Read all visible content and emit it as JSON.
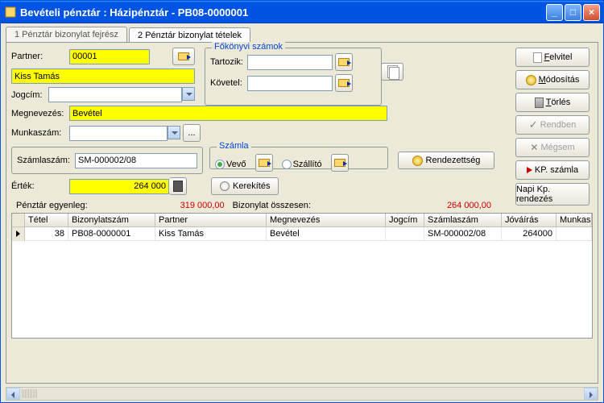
{
  "window": {
    "title": "Bevételi pénztár : Házipénztár - PB08-0000001"
  },
  "tabs": {
    "tab1": "1 Pénztár bizonylat fejrész",
    "tab2": "2 Pénztár bizonylat tételek"
  },
  "labels": {
    "partner": "Partner:",
    "jogcim": "Jogcím:",
    "megnevezes": "Megnevezés:",
    "munkaszam": "Munkaszám:",
    "szamlaszam": "Számlaszám:",
    "ertek": "Érték:",
    "tartozik": "Tartozik:",
    "kovetel": "Követel:",
    "fokonyvi": "Főkönyvi számok",
    "szamla": "Számla",
    "vevo": "Vevő",
    "szallito": "Szállító",
    "egyenleg": "Pénztár egyenleg:",
    "bizOsszesen": "Bizonylat összesen:"
  },
  "fields": {
    "partnerCode": "00001",
    "partnerName": "Kiss Tamás",
    "jogcim": "",
    "megnevezes": "Bevétel",
    "munkaszam": "",
    "szamlaszam": "SM-000002/08",
    "ertek": "264 000",
    "tartozik": "",
    "kovetel": ""
  },
  "summary": {
    "egyenleg": "319 000,00",
    "bizOsszesen": "264 000,00"
  },
  "buttons": {
    "felvitel": "Felvitel",
    "modositas": "Módosítás",
    "torles": "Törlés",
    "rendben": "Rendben",
    "megsem": "Mégsem",
    "kpSzamla": "KP. számla",
    "napiRendezes": "Napi Kp. rendezés",
    "rendezettseg": "Rendezettség",
    "kerekites": "Kerekítés",
    "ellipsis": "..."
  },
  "grid": {
    "headers": {
      "tetel": "Tétel",
      "bizszam": "Bizonylatszám",
      "partner": "Partner",
      "megnev": "Megnevezés",
      "jogcim": "Jogcím",
      "szamsz": "Számlaszám",
      "jovairas": "Jóváírás",
      "munkasz": "Munkaszár"
    },
    "row": {
      "tetel": "38",
      "bizszam": "PB08-0000001",
      "partner": "Kiss Tamás",
      "megnev": "Bevétel",
      "jogcim": "",
      "szamsz": "SM-000002/08",
      "jovairas": "264000",
      "munkasz": ""
    }
  }
}
